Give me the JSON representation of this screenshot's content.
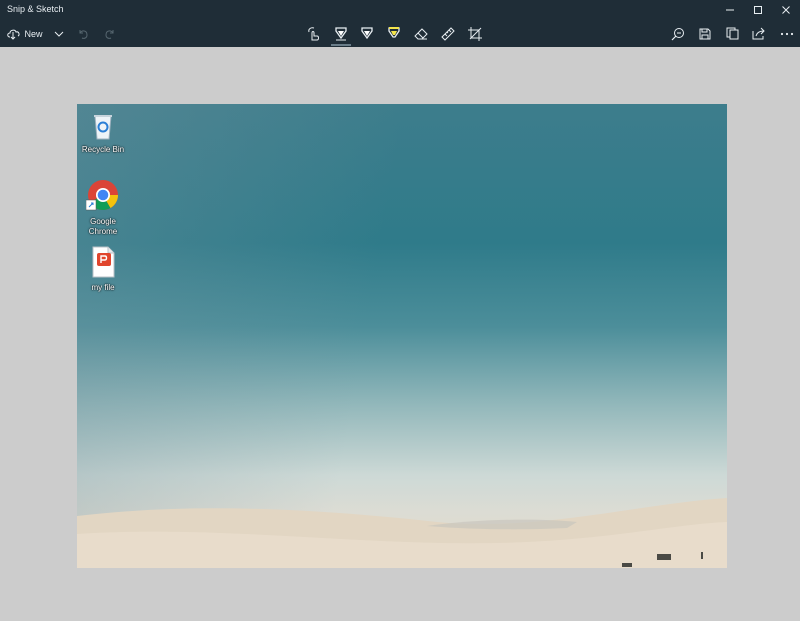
{
  "window": {
    "title": "Snip & Sketch",
    "controls": {
      "minimize": "minimize-icon",
      "maximize": "maximize-icon",
      "close": "close-icon"
    }
  },
  "toolbar": {
    "new_label": "New",
    "left_icons": [
      "new-snip-icon",
      "chevron-down-icon",
      "undo-icon",
      "redo-icon"
    ],
    "center_tools": [
      "touch-writing-icon",
      "ballpoint-pen-icon",
      "pencil-icon",
      "highlighter-icon",
      "eraser-icon",
      "ruler-icon",
      "crop-icon"
    ],
    "right_tools": [
      "zoom-icon",
      "save-icon",
      "copy-icon",
      "share-icon",
      "more-icon"
    ],
    "selected_tool": "ballpoint-pen-icon",
    "highlighter_color": "#f3e44b"
  },
  "screenshot": {
    "desktop_icons": [
      {
        "label": "Recycle Bin",
        "icon": "recycle-bin-icon"
      },
      {
        "label": "Google Chrome",
        "icon": "chrome-icon"
      },
      {
        "label": "my file",
        "icon": "pdf-file-icon"
      }
    ]
  },
  "colors": {
    "chrome": "#1f2d37",
    "canvas": "#cccccc",
    "sky": "#2f7b8a",
    "sand": "#e3d9c7"
  }
}
